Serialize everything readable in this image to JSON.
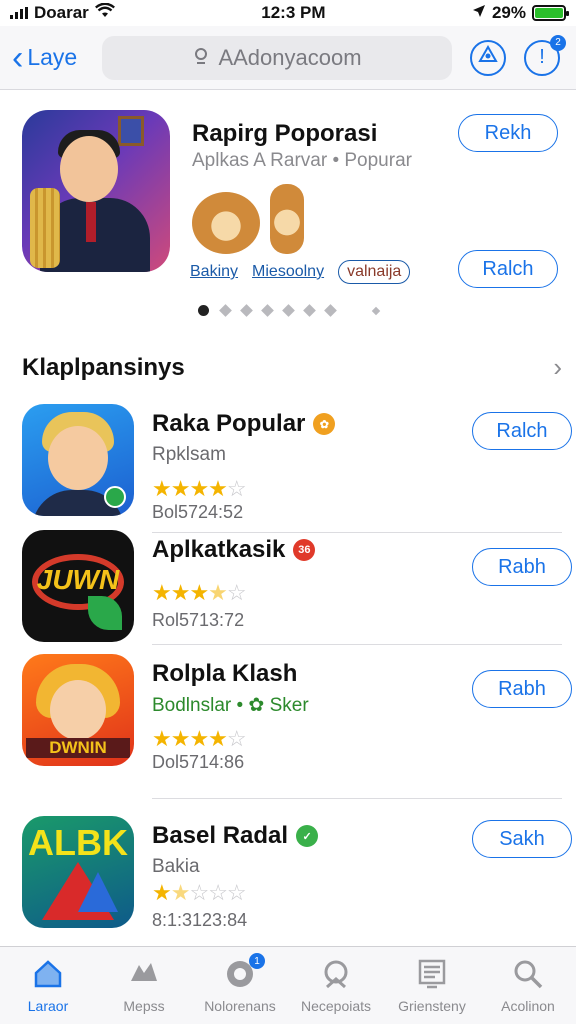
{
  "status_bar": {
    "carrier": "Doarar",
    "time": "12:3 PM",
    "battery": "29%"
  },
  "nav": {
    "back_label": "Laye",
    "search_placeholder": "AAdonyacoom",
    "notification_badge": "2"
  },
  "featured": {
    "title": "Rapirg Poporasi",
    "subtitle": "Aplkas A Rarvar • Popurar",
    "tags": [
      "Bakiny",
      "Miesoolny",
      "valnaija"
    ],
    "button1": "Rekh",
    "button2": "Ralch"
  },
  "section": {
    "title": "Klaplpansinys",
    "more": "›"
  },
  "apps": [
    {
      "name": "Raka Popular",
      "badge_color": "#f0a020",
      "subtitle": "Rpklsam",
      "rating": 4,
      "count": "Bol5724:52",
      "button": "Ralch"
    },
    {
      "name": "Aplkatkasik",
      "badge_color": "#e03a2a",
      "badge_text": "36",
      "subtitle": "",
      "rating": 3.5,
      "count": "Rol5713:72",
      "button": "Rabh"
    },
    {
      "name": "Rolpla Klash",
      "badge_color": "",
      "subtitle": "Bodlnslar • ✿ Sker",
      "rating": 4,
      "count": "Dol5714:86",
      "button": "Rabh"
    },
    {
      "name": "Basel Radal",
      "badge_color": "#3ab04a",
      "subtitle": "Bakia",
      "rating": 1.5,
      "count": "8:1:3123:84",
      "button": "Sakh"
    }
  ],
  "icons": {
    "ic2_text": "JUWN",
    "ic3_text": "DWNIN",
    "ic4_text": "ALBK"
  },
  "tabs": [
    {
      "label": "Laraor",
      "icon": "home-icon",
      "active": true
    },
    {
      "label": "Mepss",
      "icon": "games-icon",
      "active": false
    },
    {
      "label": "Nolorenans",
      "icon": "apps-icon",
      "active": false,
      "badge": "1"
    },
    {
      "label": "Necepoiats",
      "icon": "arcade-icon",
      "active": false
    },
    {
      "label": "Griensteny",
      "icon": "updates-icon",
      "active": false
    },
    {
      "label": "Acolinon",
      "icon": "search-icon",
      "active": false
    }
  ]
}
